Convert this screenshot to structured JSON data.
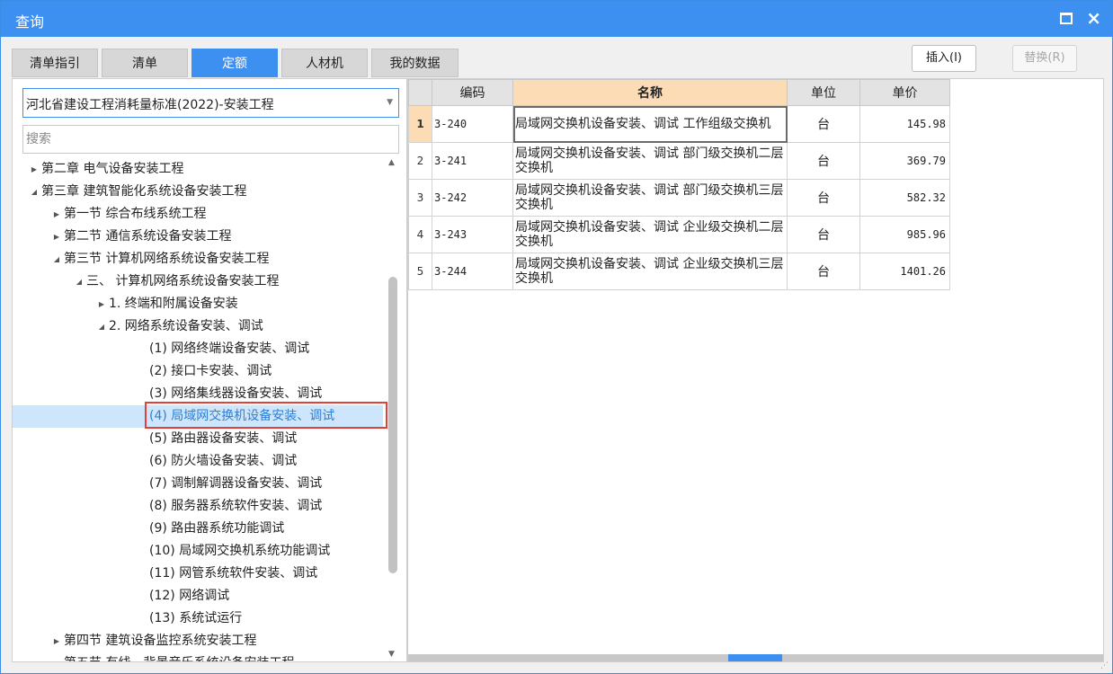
{
  "window": {
    "title": "查询"
  },
  "tabs": [
    "清单指引",
    "清单",
    "定额",
    "人材机",
    "我的数据"
  ],
  "active_tab": "定额",
  "buttons": {
    "insert": "插入(I)",
    "replace": "替换(R)"
  },
  "library_select": {
    "value": "河北省建设工程消耗量标准(2022)-安装工程"
  },
  "search": {
    "placeholder": "搜索"
  },
  "tree": [
    {
      "label": "第二章 电气设备安装工程",
      "level": 0,
      "state": "collapsed"
    },
    {
      "label": "第三章 建筑智能化系统设备安装工程",
      "level": 0,
      "state": "expanded"
    },
    {
      "label": "第一节 综合布线系统工程",
      "level": 1,
      "state": "collapsed"
    },
    {
      "label": "第二节 通信系统设备安装工程",
      "level": 1,
      "state": "collapsed"
    },
    {
      "label": "第三节 计算机网络系统设备安装工程",
      "level": 1,
      "state": "expanded"
    },
    {
      "label": "三、 计算机网络系统设备安装工程",
      "level": 2,
      "state": "expanded"
    },
    {
      "label": "1. 终端和附属设备安装",
      "level": 3,
      "state": "collapsed"
    },
    {
      "label": "2. 网络系统设备安装、调试",
      "level": 3,
      "state": "expanded"
    },
    {
      "label": "(1) 网络终端设备安装、调试",
      "level": 4,
      "state": "leaf"
    },
    {
      "label": "(2) 接口卡安装、调试",
      "level": 4,
      "state": "leaf"
    },
    {
      "label": "(3) 网络集线器设备安装、调试",
      "level": 4,
      "state": "leaf"
    },
    {
      "label": "(4) 局域网交换机设备安装、调试",
      "level": 4,
      "state": "leaf",
      "selected": true
    },
    {
      "label": "(5) 路由器设备安装、调试",
      "level": 4,
      "state": "leaf"
    },
    {
      "label": "(6) 防火墙设备安装、调试",
      "level": 4,
      "state": "leaf"
    },
    {
      "label": "(7) 调制解调器设备安装、调试",
      "level": 4,
      "state": "leaf"
    },
    {
      "label": "(8) 服务器系统软件安装、调试",
      "level": 4,
      "state": "leaf"
    },
    {
      "label": "(9) 路由器系统功能调试",
      "level": 4,
      "state": "leaf"
    },
    {
      "label": "(10) 局域网交换机系统功能调试",
      "level": 4,
      "state": "leaf"
    },
    {
      "label": "(11) 网管系统软件安装、调试",
      "level": 4,
      "state": "leaf"
    },
    {
      "label": "(12) 网络调试",
      "level": 4,
      "state": "leaf"
    },
    {
      "label": "(13) 系统试运行",
      "level": 4,
      "state": "leaf"
    },
    {
      "label": "第四节 建筑设备监控系统安装工程",
      "level": 1,
      "state": "collapsed"
    },
    {
      "label": "第五节 有线、背景音乐系统设备安装工程",
      "level": 1,
      "state": "collapsed"
    }
  ],
  "table": {
    "headers": [
      "",
      "编码",
      "名称",
      "单位",
      "单价"
    ],
    "rows": [
      {
        "no": "1",
        "code": "3-240",
        "name": "局域网交换机设备安装、调试 工作组级交换机",
        "unit": "台",
        "price": "145.98"
      },
      {
        "no": "2",
        "code": "3-241",
        "name": "局域网交换机设备安装、调试 部门级交换机二层交换机",
        "unit": "台",
        "price": "369.79"
      },
      {
        "no": "3",
        "code": "3-242",
        "name": "局域网交换机设备安装、调试 部门级交换机三层交换机",
        "unit": "台",
        "price": "582.32"
      },
      {
        "no": "4",
        "code": "3-243",
        "name": "局域网交换机设备安装、调试 企业级交换机二层交换机",
        "unit": "台",
        "price": "985.96"
      },
      {
        "no": "5",
        "code": "3-244",
        "name": "局域网交换机设备安装、调试 企业级交换机三层交换机",
        "unit": "台",
        "price": "1401.26"
      }
    ]
  },
  "colors": {
    "accent": "#3d8ff0",
    "selection": "#cde6fb",
    "highlight_box": "#e0413a",
    "name_header": "#fbdcb5"
  }
}
